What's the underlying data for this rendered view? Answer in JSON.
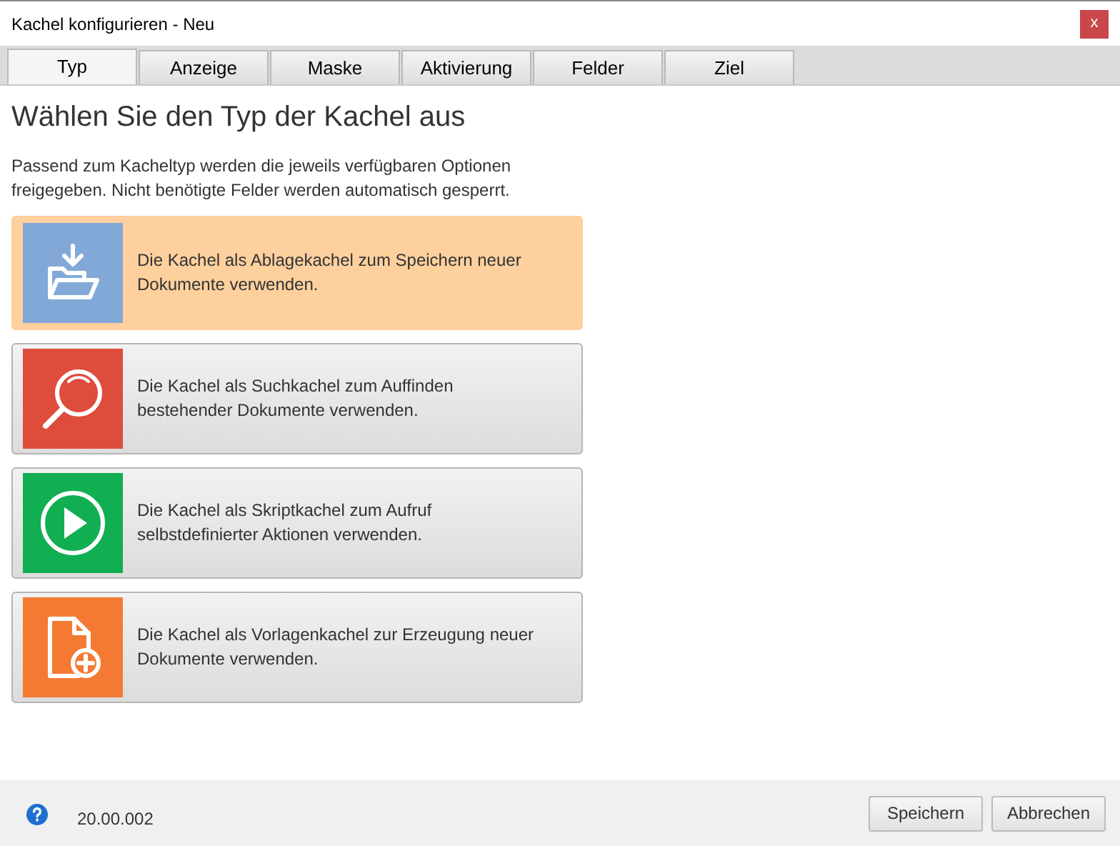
{
  "window": {
    "title": "Kachel konfigurieren - Neu",
    "close": "x"
  },
  "tabs": [
    {
      "label": "Typ",
      "selected": true
    },
    {
      "label": "Anzeige",
      "selected": false
    },
    {
      "label": "Maske",
      "selected": false
    },
    {
      "label": "Aktivierung",
      "selected": false
    },
    {
      "label": "Felder",
      "selected": false
    },
    {
      "label": "Ziel",
      "selected": false
    }
  ],
  "heading": "Wählen Sie den Typ der Kachel aus",
  "description": "Passend zum Kacheltyp werden die jeweils verfügbaren Optionen freigegeben. Nicht benötigte Felder werden automatisch gesperrt.",
  "tiles": [
    {
      "kind": "store",
      "color": "#82a8d8",
      "selected": true,
      "text": "Die Kachel als Ablagekachel zum Speichern neuer Dokumente verwenden."
    },
    {
      "kind": "search",
      "color": "#de4c3c",
      "selected": false,
      "text": "Die Kachel als Suchkachel zum Auffinden bestehender Dokumente verwenden."
    },
    {
      "kind": "script",
      "color": "#12ae52",
      "selected": false,
      "text": "Die Kachel als Skriptkachel zum Aufruf selbstdefinierter Aktionen verwenden."
    },
    {
      "kind": "template",
      "color": "#f47a34",
      "selected": false,
      "text": "Die Kachel als Vorlagenkachel zur Erzeugung neuer Dokumente verwenden."
    }
  ],
  "footer": {
    "version": "20.00.002",
    "buttons": [
      "Speichern",
      "Abbrechen"
    ]
  }
}
